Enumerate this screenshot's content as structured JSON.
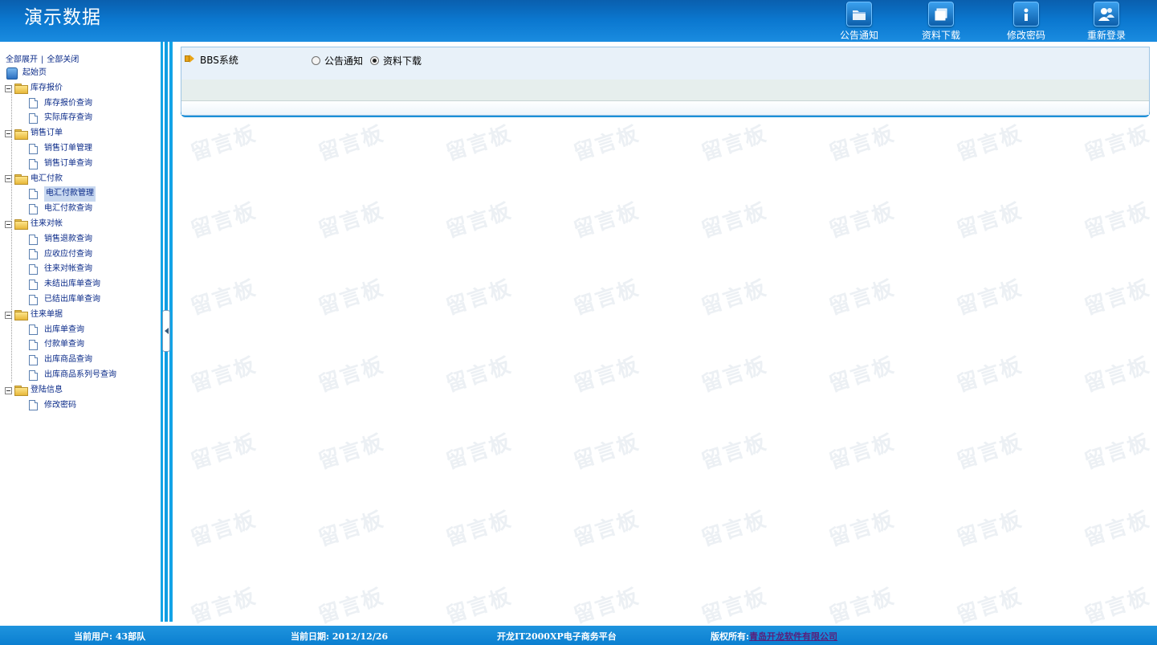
{
  "header": {
    "title": "演示数据",
    "nav": [
      {
        "label": "公告通知",
        "icon": "folder-icon"
      },
      {
        "label": "资料下载",
        "icon": "window-icon"
      },
      {
        "label": "修改密码",
        "icon": "info-icon"
      },
      {
        "label": "重新登录",
        "icon": "users-icon"
      }
    ]
  },
  "sidebar": {
    "expand_all": "全部展开",
    "separator": "|",
    "collapse_all": "全部关闭",
    "home": "起始页",
    "groups": [
      {
        "label": "库存报价",
        "items": [
          "库存报价查询",
          "实际库存查询"
        ]
      },
      {
        "label": "销售订单",
        "items": [
          "销售订单管理",
          "销售订单查询"
        ]
      },
      {
        "label": "电汇付款",
        "items": [
          "电汇付款管理",
          "电汇付款查询"
        ]
      },
      {
        "label": "往来对帐",
        "items": [
          "销售退款查询",
          "应收应付查询",
          "往来对帐查询",
          "未结出库单查询",
          "已结出库单查询"
        ]
      },
      {
        "label": "往来单据",
        "items": [
          "出库单查询",
          "付款单查询",
          "出库商品查询",
          "出库商品系列号查询"
        ]
      },
      {
        "label": "登陆信息",
        "items": [
          "修改密码"
        ]
      }
    ],
    "selected_item": "电汇付款管理"
  },
  "main": {
    "panel_title": "BBS系统",
    "radio_options": [
      {
        "label": "公告通知",
        "checked": false
      },
      {
        "label": "资料下载",
        "checked": true
      }
    ],
    "watermark": "留言板"
  },
  "footer": {
    "current_user": "当前用户: 43部队",
    "current_date": "当前日期: 2012/12/26",
    "platform": "开龙IT2000XP电子商务平台",
    "copyright_prefix": "版权所有:",
    "copyright_link": "青岛开龙软件有限公司"
  }
}
